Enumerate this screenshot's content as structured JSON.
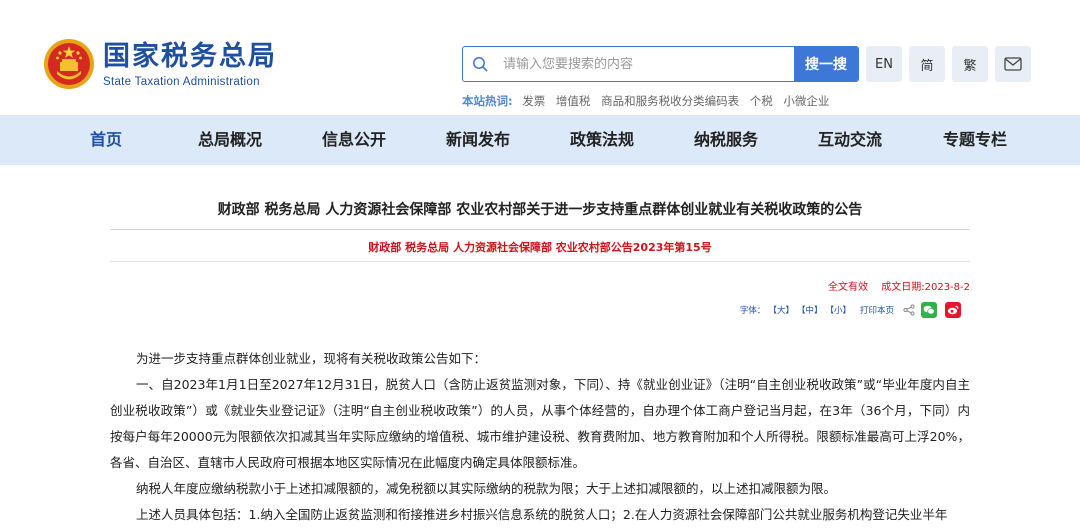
{
  "header": {
    "logo_cn": "国家税务总局",
    "logo_en": "State Taxation Administration"
  },
  "search": {
    "placeholder": "请输入您要搜索的内容",
    "button": "搜一搜"
  },
  "hot": {
    "label": "本站热词:",
    "items": [
      "发票",
      "增值税",
      "商品和服务税收分类编码表",
      "个税",
      "小微企业"
    ]
  },
  "lang": {
    "en": "EN",
    "simplified": "简",
    "traditional": "繁"
  },
  "nav": {
    "items": [
      "首页",
      "总局概况",
      "信息公开",
      "新闻发布",
      "政策法规",
      "纳税服务",
      "互动交流",
      "专题专栏"
    ]
  },
  "article": {
    "title": "财政部 税务总局 人力资源社会保障部 农业农村部关于进一步支持重点群体创业就业有关税收政策的公告",
    "subtitle": "财政部 税务总局 人力资源社会保障部 农业农村部公告2023年第15号",
    "validity": "全文有效",
    "date": "成文日期:2023-8-2",
    "font_label": "字体：",
    "font_large": "【大】",
    "font_medium": "【中】",
    "font_small": "【小】",
    "print": "打印本页",
    "paragraphs": [
      "为进一步支持重点群体创业就业，现将有关税收政策公告如下：",
      "一、自2023年1月1日至2027年12月31日，脱贫人口（含防止返贫监测对象，下同）、持《就业创业证》（注明“自主创业税收政策”或“毕业年度内自主创业税收政策”）或《就业失业登记证》（注明“自主创业税收政策”）的人员，从事个体经营的，自办理个体工商户登记当月起，在3年（36个月，下同）内按每户每年20000元为限额依次扣减其当年实际应缴纳的增值税、城市维护建设税、教育费附加、地方教育附加和个人所得税。限额标准最高可上浮20%，各省、自治区、直辖市人民政府可根据本地区实际情况在此幅度内确定具体限额标准。",
      "纳税人年度应缴纳税款小于上述扣减限额的，减免税额以其实际缴纳的税款为限；大于上述扣减限额的，以上述扣减限额为限。",
      "上述人员具体包括：1.纳入全国防止返贫监测和衔接推进乡村振兴信息系统的脱贫人口；2.在人力资源社会保障部门公共就业服务机构登记失业半年"
    ]
  },
  "colors": {
    "brand": "#1f4fa0",
    "accent": "#3d78d6",
    "nav_bg": "#dce9f8",
    "red": "#d0121b"
  }
}
